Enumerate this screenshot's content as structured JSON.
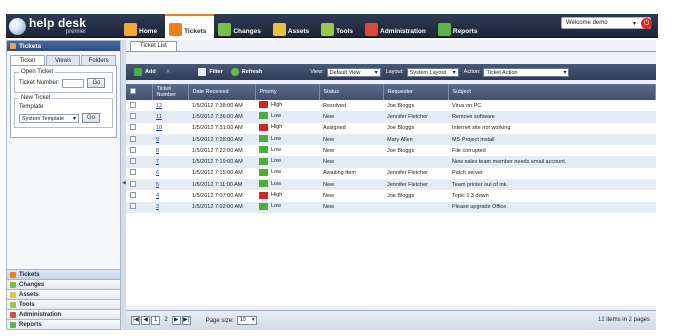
{
  "app": {
    "logo_main": "help desk",
    "logo_sub": "premier"
  },
  "nav": [
    {
      "label": "Home",
      "icon": "home-icon",
      "color": "#f2a73b"
    },
    {
      "label": "Tickets",
      "icon": "tickets-icon",
      "color": "#f07f1a",
      "active": true
    },
    {
      "label": "Changes",
      "icon": "changes-icon",
      "color": "#79c04a"
    },
    {
      "label": "Assets",
      "icon": "assets-icon",
      "color": "#e6c33b"
    },
    {
      "label": "Tools",
      "icon": "tools-icon",
      "color": "#9ac84a"
    },
    {
      "label": "Administration",
      "icon": "administration-icon",
      "color": "#d84a3a"
    },
    {
      "label": "Reports",
      "icon": "reports-icon",
      "color": "#62b24a"
    }
  ],
  "user_menu": {
    "label": "Welcome demo"
  },
  "left": {
    "header": "Tickets",
    "tabs": [
      "Ticket",
      "Views",
      "Folders"
    ],
    "open_ticket": {
      "legend": "Open Ticket",
      "label": "Ticket Number:",
      "button": "Go"
    },
    "new_ticket": {
      "legend": "New Ticket",
      "template_label": "Template",
      "template_value": "System Template",
      "button": "Go"
    },
    "accordion": [
      {
        "label": "Tickets",
        "active": true,
        "color": "#f07f1a"
      },
      {
        "label": "Changes",
        "color": "#79c04a"
      },
      {
        "label": "Assets",
        "color": "#e6c33b"
      },
      {
        "label": "Tools",
        "color": "#9ac84a"
      },
      {
        "label": "Administration",
        "color": "#d84a3a"
      },
      {
        "label": "Reports",
        "color": "#62b24a"
      }
    ]
  },
  "main": {
    "tab": "Ticket List",
    "toolbar": {
      "add": "Add",
      "filter": "Filter",
      "refresh": "Refresh",
      "view_label": "View:",
      "view_value": "Default View",
      "layout_label": "Layout:",
      "layout_value": "System Layout",
      "action_label": "Action:",
      "action_value": "Ticket Action"
    },
    "columns": [
      "Ticket Number",
      "Date Received",
      "Priority",
      "Status",
      "Requester",
      "Subject"
    ],
    "rows": [
      {
        "num": "12",
        "date": "1/5/2012 7:38:00 AM",
        "priority": "High",
        "status": "Resolved",
        "requester": "Joe Bloggs",
        "subject": "Virus on PC"
      },
      {
        "num": "11",
        "date": "1/5/2012 7:36:00 AM",
        "priority": "Low",
        "status": "New",
        "requester": "Jennifer Fletcher",
        "subject": "Remove software"
      },
      {
        "num": "10",
        "date": "1/5/2012 7:31:00 AM",
        "priority": "High",
        "status": "Assigned",
        "requester": "Joe Bloggs",
        "subject": "Internet site not working"
      },
      {
        "num": "9",
        "date": "1/5/2012 7:28:00 AM",
        "priority": "Low",
        "status": "New",
        "requester": "Mary Allen",
        "subject": "MS Project install"
      },
      {
        "num": "8",
        "date": "1/5/2012 7:22:00 AM",
        "priority": "Low",
        "status": "New",
        "requester": "Joe Bloggs",
        "subject": "File corrupted"
      },
      {
        "num": "7",
        "date": "1/5/2012 7:19:00 AM",
        "priority": "Low",
        "status": "New",
        "requester": "",
        "subject": "New sales team member needs email account."
      },
      {
        "num": "6",
        "date": "1/5/2012 7:15:00 AM",
        "priority": "Low",
        "status": "Awaiting Item",
        "requester": "Jennifer Fletcher",
        "subject": "Patch server"
      },
      {
        "num": "5",
        "date": "1/5/2012 7:11:00 AM",
        "priority": "Low",
        "status": "New",
        "requester": "Jennifer Fletcher",
        "subject": "Team printer out of ink."
      },
      {
        "num": "4",
        "date": "1/5/2012 7:07:00 AM",
        "priority": "High",
        "status": "New",
        "requester": "Joe Bloggs",
        "subject": "Topic 1.3 down"
      },
      {
        "num": "3",
        "date": "1/5/2012 7:02:00 AM",
        "priority": "Low",
        "status": "New",
        "requester": "",
        "subject": "Please upgrade Office."
      }
    ],
    "priority_colors": {
      "High": "#d2232a",
      "Low": "#4cae3a"
    },
    "pager": {
      "pages": [
        "1",
        "2"
      ],
      "page_size_label": "Page size:",
      "page_size": "10",
      "info_count": "12",
      "info_mid": "items in",
      "info_pages": "2",
      "info_end": "pages"
    }
  }
}
